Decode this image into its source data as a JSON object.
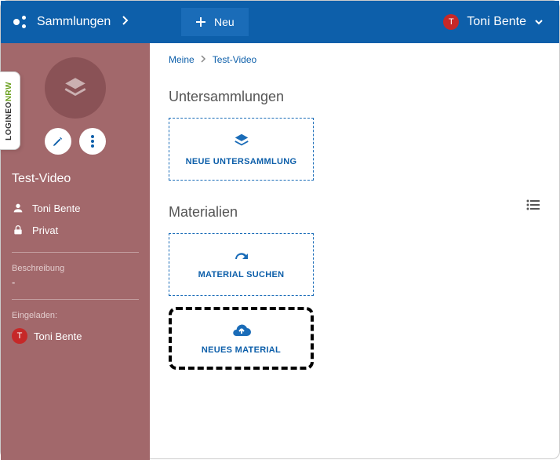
{
  "topbar": {
    "title": "Sammlungen",
    "new_label": "Neu",
    "user_initial": "T",
    "user_name": "Toni Bente"
  },
  "sidetab": {
    "text_a": "LOGINEO",
    "text_b": "NRW"
  },
  "sidebar": {
    "title": "Test-Video",
    "owner": "Toni Bente",
    "visibility": "Privat",
    "desc_label": "Beschreibung",
    "desc_value": "-",
    "invited_label": "Eingeladen:",
    "invited_initial": "T",
    "invited_name": "Toni Bente"
  },
  "breadcrumb": {
    "root": "Meine",
    "current": "Test-Video"
  },
  "sections": {
    "sub_title": "Untersammlungen",
    "new_sub_label": "NEUE UNTERSAMMLUNG",
    "mat_title": "Materialien",
    "search_mat_label": "MATERIAL SUCHEN",
    "new_mat_label": "NEUES MATERIAL"
  }
}
